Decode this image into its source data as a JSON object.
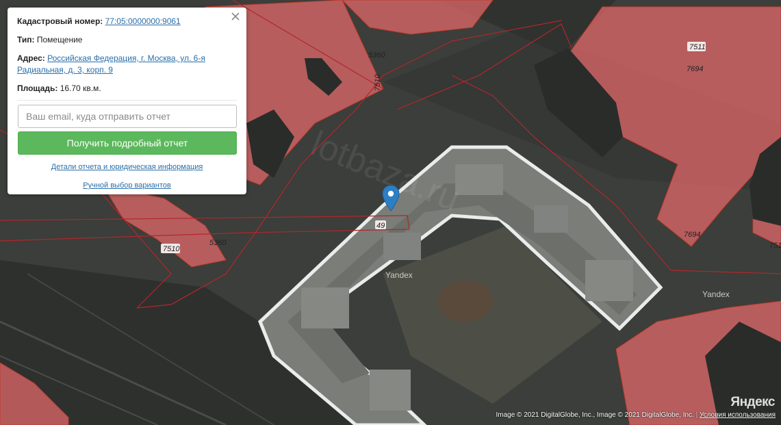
{
  "popup": {
    "cadastral_label": "Кадастровый номер:",
    "cadastral_value": "77:05:0000000:9061",
    "type_label": "Тип:",
    "type_value": "Помещение",
    "address_label": "Адрес:",
    "address_value": "Российская Федерация, г. Москва, ул. 6-я Радиальная, д. 3, корп. 9",
    "area_label": "Площадь:",
    "area_value": "16.70 кв.м.",
    "email_placeholder": "Ваш email, куда отправить отчет",
    "report_button": "Получить подробный отчет",
    "details_link": "Детали отчета и юридическая информация",
    "manual_link": "Ручной выбор вариантов",
    "close_icon": "close-icon"
  },
  "map": {
    "plot_labels": [
      "5360",
      "7510",
      "7511",
      "7694",
      "7694",
      "49",
      "7510",
      "5360",
      "751"
    ],
    "watermarks": [
      "Yandex",
      "Yandex"
    ],
    "faint_watermark": "lotbaza.ru",
    "logo": "Яндекс",
    "attribution": "Image © 2021 DigitalGlobe, Inc., Image © 2021 DigitalGlobe, Inc.",
    "terms_link": "Условия использования",
    "pin_color": "#2d7fc5",
    "overlay_color": "#e8696b"
  }
}
